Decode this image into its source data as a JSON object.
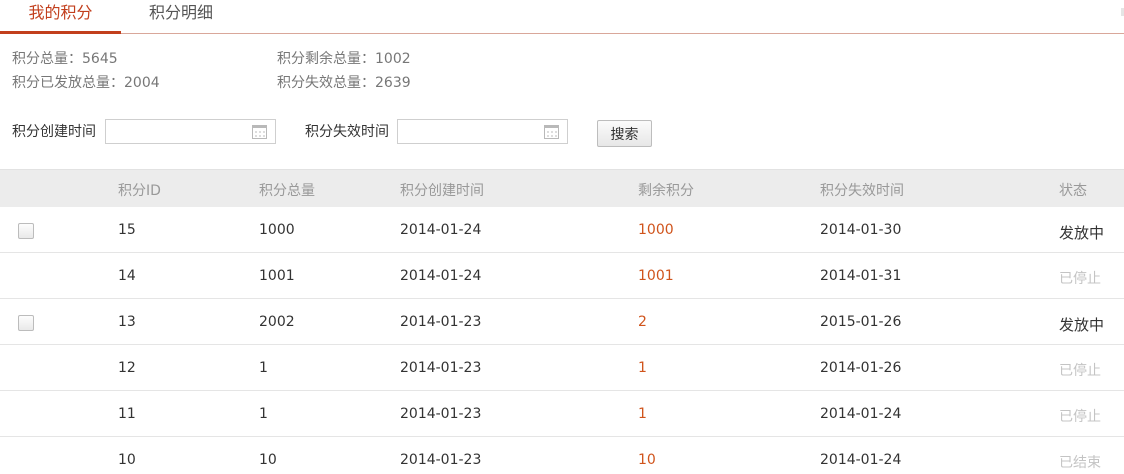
{
  "tabs": [
    {
      "label": "我的积分",
      "active": true
    },
    {
      "label": "积分明细",
      "active": false
    }
  ],
  "summary": {
    "total_label": "积分总量：",
    "total_value": "5645",
    "remain_label": "积分剩余总量：",
    "remain_value": "1002",
    "issued_label": "积分已发放总量：",
    "issued_value": "2004",
    "expired_label": "积分失效总量：",
    "expired_value": "2639"
  },
  "filters": {
    "created_label": "积分创建时间",
    "created_value": "",
    "expire_label": "积分失效时间",
    "expire_value": "",
    "search_label": "搜索"
  },
  "table": {
    "columns": [
      "积分ID",
      "积分总量",
      "积分创建时间",
      "剩余积分",
      "积分失效时间",
      "状态"
    ],
    "rows": [
      {
        "id": "15",
        "total": "1000",
        "created": "2014-01-24",
        "remain": "1000",
        "expire": "2014-01-30",
        "status": "发放中",
        "checkbox": true,
        "active": true
      },
      {
        "id": "14",
        "total": "1001",
        "created": "2014-01-24",
        "remain": "1001",
        "expire": "2014-01-31",
        "status": "已停止",
        "checkbox": false,
        "active": false
      },
      {
        "id": "13",
        "total": "2002",
        "created": "2014-01-23",
        "remain": "2",
        "expire": "2015-01-26",
        "status": "发放中",
        "checkbox": true,
        "active": true
      },
      {
        "id": "12",
        "total": "1",
        "created": "2014-01-23",
        "remain": "1",
        "expire": "2014-01-26",
        "status": "已停止",
        "checkbox": false,
        "active": false
      },
      {
        "id": "11",
        "total": "1",
        "created": "2014-01-23",
        "remain": "1",
        "expire": "2014-01-24",
        "status": "已停止",
        "checkbox": false,
        "active": false
      },
      {
        "id": "10",
        "total": "10",
        "created": "2014-01-23",
        "remain": "10",
        "expire": "2014-01-24",
        "status": "已结束",
        "checkbox": false,
        "active": false
      }
    ]
  },
  "icons": {
    "calendar": "calendar-icon"
  },
  "colors": {
    "accent": "#c23f1d",
    "remain": "#d0541c",
    "muted": "#c4c4c4"
  }
}
